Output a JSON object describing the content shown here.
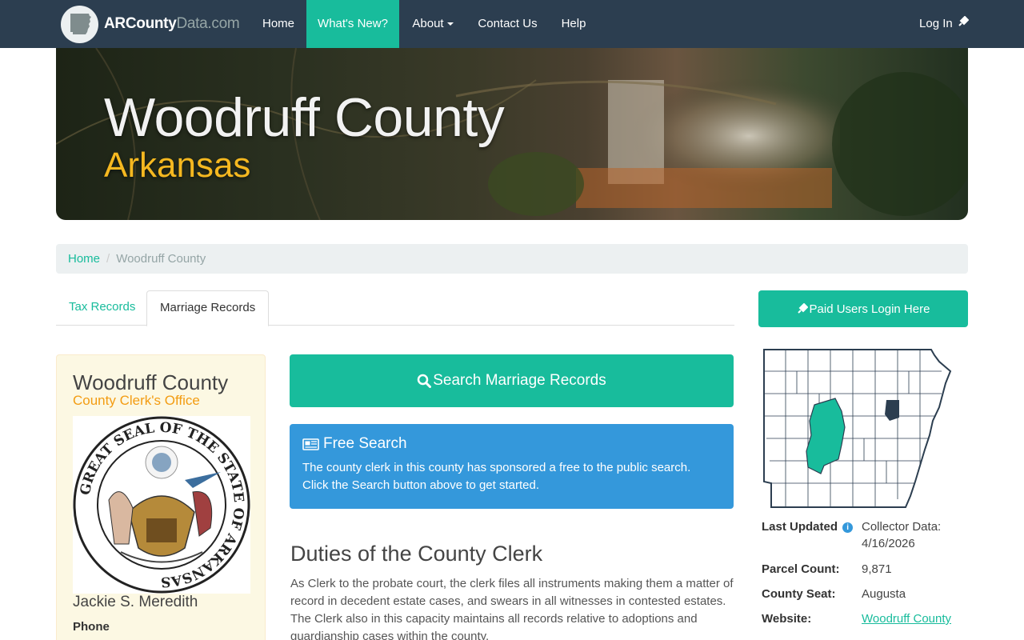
{
  "navbar": {
    "brand": {
      "part1": "ARCounty",
      "part2": "Data",
      "part3": ".com"
    },
    "items": [
      {
        "label": "Home"
      },
      {
        "label": "What's New?"
      },
      {
        "label": "About"
      },
      {
        "label": "Contact Us"
      },
      {
        "label": "Help"
      }
    ],
    "login_label": "Log In",
    "accent_color": "#18bc9c",
    "bg_color": "#2c3e50"
  },
  "hero": {
    "title": "Woodruff County",
    "subtitle": "Arkansas"
  },
  "breadcrumb": {
    "home": "Home",
    "current": "Woodruff County"
  },
  "tabs": [
    {
      "label": "Tax Records",
      "active": false
    },
    {
      "label": "Marriage Records",
      "active": true
    }
  ],
  "clerk": {
    "county": "Woodruff County",
    "office": "County Clerk's Office",
    "seal_alt": "GREAT SEAL OF THE STATE OF ARKANSAS",
    "name": "Jackie S. Meredith",
    "phone_label": "Phone"
  },
  "search": {
    "button_label": "Search Marriage Records",
    "icon": "search-icon"
  },
  "free_search": {
    "title": "Free Search",
    "line1": "The county clerk in this county has sponsored a free to the public search.",
    "line2": "Click the Search button above to get started.",
    "icon": "newspaper-icon"
  },
  "duties": {
    "title": "Duties of the County Clerk",
    "text": "As Clerk to the probate court, the clerk files all instruments making them a matter of record in decedent estate cases, and swears in all witnesses in contested estates. The Clerk also in this capacity maintains all records relative to adoptions and guardianship cases within the county."
  },
  "sidebar": {
    "login_button": "Paid Users Login Here",
    "last_updated_label": "Last Updated",
    "last_updated_value_1": "Collector Data:",
    "last_updated_value_2": "4/16/2026",
    "parcel_label": "Parcel Count:",
    "parcel_value": "9,871",
    "seat_label": "County Seat:",
    "seat_value": "Augusta",
    "website_label": "Website:",
    "website_value": "Woodruff County"
  }
}
